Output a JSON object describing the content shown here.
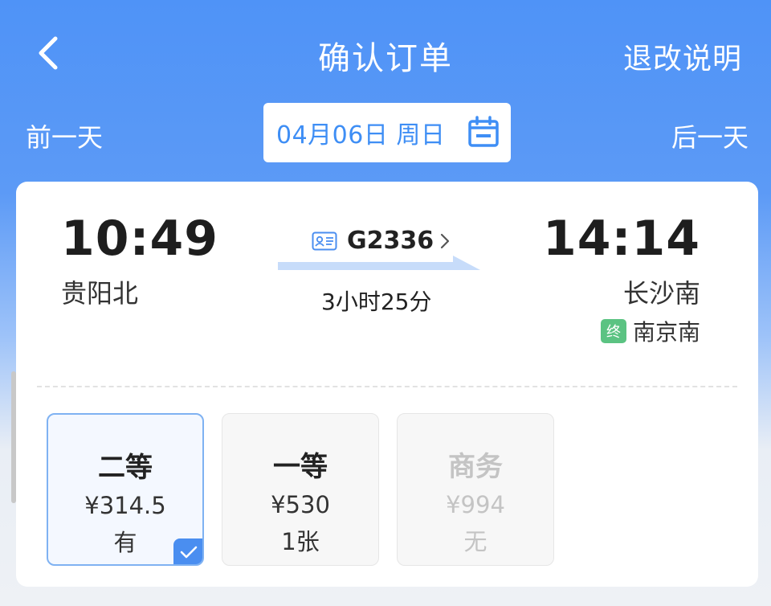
{
  "header": {
    "title": "确认订单",
    "refund_link": "退改说明"
  },
  "date_bar": {
    "prev_label": "前一天",
    "date": "04月06日 周日",
    "next_label": "后一天"
  },
  "trip": {
    "departure_time": "10:49",
    "departure_station": "贵阳北",
    "train_number": "G2336",
    "duration": "3小时25分",
    "arrival_time": "14:14",
    "arrival_station": "长沙南",
    "terminus_badge": "终",
    "terminus_station": "南京南"
  },
  "seats": [
    {
      "name": "二等",
      "price": "¥314.5",
      "availability": "有",
      "selected": true,
      "disabled": false
    },
    {
      "name": "一等",
      "price": "¥530",
      "availability": "1张",
      "selected": false,
      "disabled": false
    },
    {
      "name": "商务",
      "price": "¥994",
      "availability": "无",
      "selected": false,
      "disabled": true
    }
  ],
  "colors": {
    "brand_blue": "#4f93f7",
    "accent_blue": "#3e8ef5",
    "terminus_green": "#5bc382"
  },
  "icons": {
    "back": "chevron-left-icon",
    "calendar": "calendar-icon",
    "train_id": "id-card-icon",
    "detail": "chevron-right-icon",
    "selected": "checkmark-icon"
  }
}
